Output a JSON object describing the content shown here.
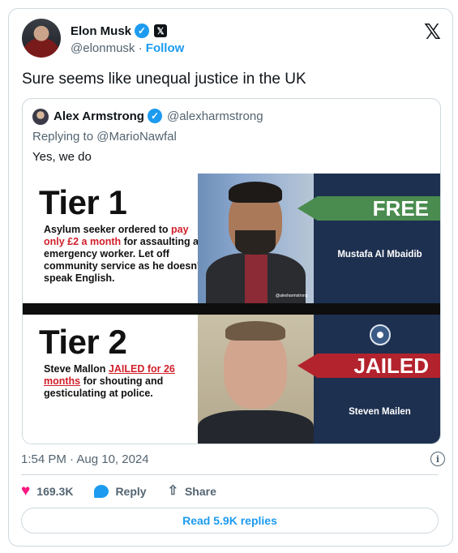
{
  "author": {
    "name": "Elon Musk",
    "handle": "@elonmusk",
    "separator": "·",
    "follow_label": "Follow",
    "verified_icon": "verified-badge",
    "affiliate_icon": "x-badge"
  },
  "tweet": {
    "text": "Sure seems like unequal justice in the UK"
  },
  "quoted": {
    "name": "Alex Armstrong",
    "handle": "@alexharmstrong",
    "reply_prefix": "Replying to",
    "reply_to": "@MarioNawfal",
    "text": "Yes, we do"
  },
  "meme": {
    "tier1": {
      "title": "Tier 1",
      "desc_a": "Asylum seeker ordered to ",
      "desc_red": "pay only £2 a month",
      "desc_b": " for assaulting an emergency worker. Let off community service as he doesn't speak English.",
      "banner": "FREE",
      "subject": "Mustafa Al Mbaidib",
      "watermark": "@alexharmstrong"
    },
    "tier2": {
      "title": "Tier 2",
      "desc_a": "Steve Mallon ",
      "desc_red": "JAILED for 26 months",
      "desc_b": " for shouting and gesticulating at police.",
      "banner": "JAILED",
      "subject": "Steven Mailen"
    }
  },
  "footer": {
    "timestamp": "1:54 PM · Aug 10, 2024",
    "likes": "169.3K",
    "reply_label": "Reply",
    "share_label": "Share",
    "read_replies": "Read 5.9K replies"
  },
  "colors": {
    "accent": "#1d9bf0",
    "like": "#f91880",
    "free_banner": "#4a8c4f",
    "jailed_banner": "#b3232d",
    "panel_blue": "#1d3050"
  }
}
